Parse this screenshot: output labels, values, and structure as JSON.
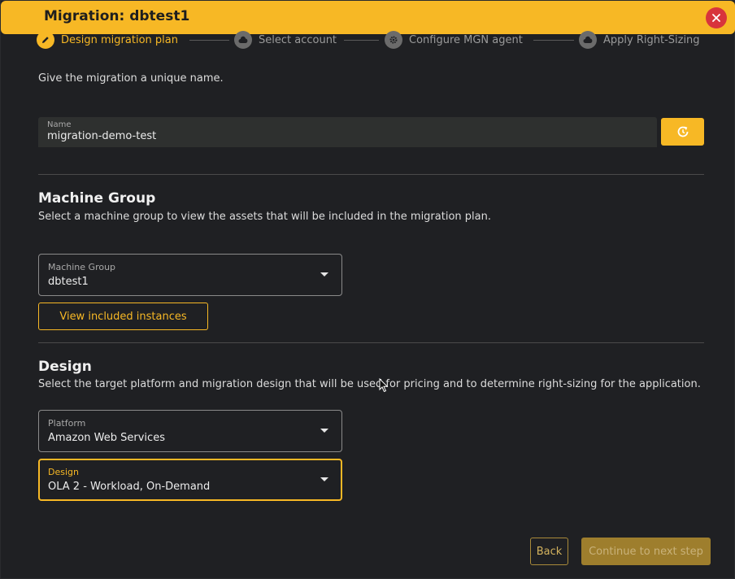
{
  "header": {
    "title": "Migration: dbtest1",
    "close_icon": "close-icon"
  },
  "stepper": {
    "steps": [
      {
        "label": "Design migration plan",
        "icon": "pencil-icon",
        "active": true
      },
      {
        "label": "Select account",
        "icon": "cloud-icon",
        "active": false
      },
      {
        "label": "Configure MGN agent",
        "icon": "gear-icon",
        "active": false
      },
      {
        "label": "Apply Right-Sizing",
        "icon": "cloud-icon",
        "active": false
      }
    ]
  },
  "name_section": {
    "instruction": "Give the migration a unique name.",
    "field_label": "Name",
    "field_value": "migration-demo-test",
    "refresh_icon": "refresh-icon"
  },
  "machine_group": {
    "title": "Machine Group",
    "description": "Select a machine group to view the assets that will be included in the migration plan.",
    "select_label": "Machine Group",
    "select_value": "dbtest1",
    "view_button": "View included instances"
  },
  "design": {
    "title": "Design",
    "description": "Select the target platform and migration design that will be used for pricing and to determine right-sizing for the application.",
    "platform_label": "Platform",
    "platform_value": "Amazon Web Services",
    "design_label": "Design",
    "design_value": "OLA 2 - Workload, On-Demand"
  },
  "footer": {
    "back_label": "Back",
    "continue_label": "Continue to next step"
  },
  "colors": {
    "accent": "#f7b825",
    "background": "#1f2023",
    "close": "#d8343c"
  }
}
